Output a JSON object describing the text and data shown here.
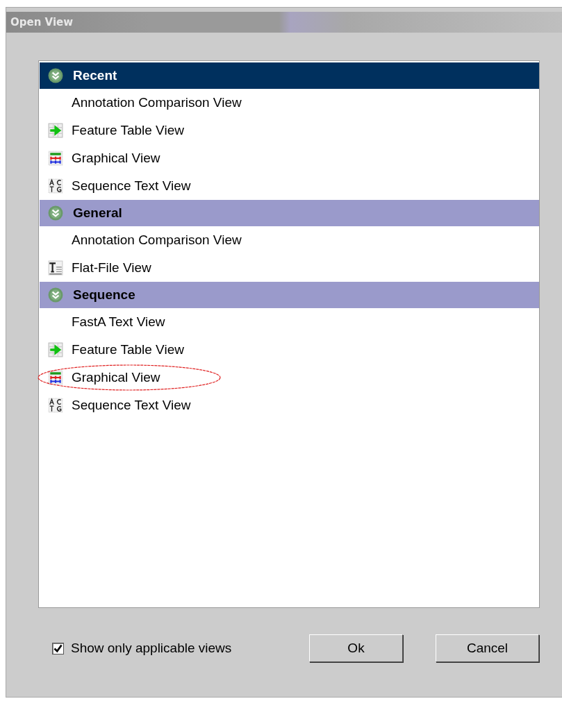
{
  "window": {
    "title": "Open View"
  },
  "groups": [
    {
      "label": "Recent",
      "selected": true,
      "items": [
        {
          "label": "Annotation Comparison View",
          "kind": "plain",
          "circled": false
        },
        {
          "label": "Feature Table View",
          "kind": "table",
          "circled": false
        },
        {
          "label": "Graphical View",
          "kind": "graphical",
          "circled": false
        },
        {
          "label": "Sequence Text View",
          "kind": "sequence",
          "circled": false
        }
      ]
    },
    {
      "label": "General",
      "selected": false,
      "items": [
        {
          "label": "Annotation Comparison View",
          "kind": "plain",
          "circled": false
        },
        {
          "label": "Flat-File View",
          "kind": "flatfile",
          "circled": false
        }
      ]
    },
    {
      "label": "Sequence",
      "selected": false,
      "items": [
        {
          "label": "FastA Text View",
          "kind": "plain",
          "circled": false
        },
        {
          "label": "Feature Table View",
          "kind": "table",
          "circled": false
        },
        {
          "label": "Graphical View",
          "kind": "graphical",
          "circled": true
        },
        {
          "label": "Sequence Text View",
          "kind": "sequence",
          "circled": false
        }
      ]
    }
  ],
  "checkbox": {
    "label": "Show only applicable views",
    "checked": true
  },
  "buttons": [
    "Ok",
    "Cancel"
  ]
}
